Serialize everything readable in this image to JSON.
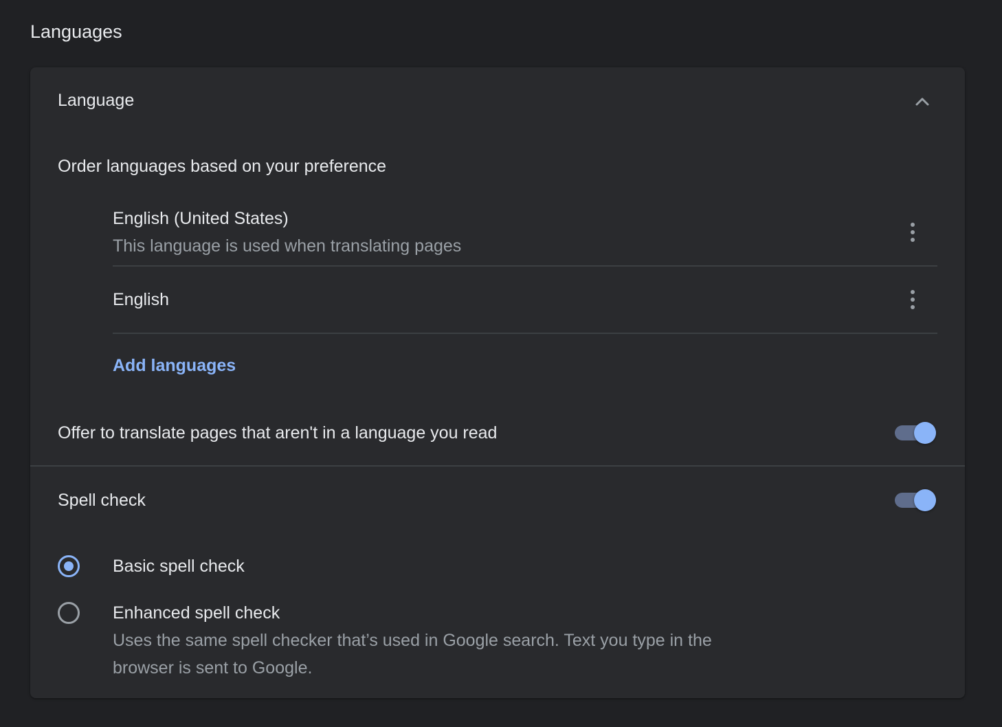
{
  "page": {
    "title": "Languages"
  },
  "language_section": {
    "title": "Language",
    "expanded": true,
    "chevron_icon": "chevron-up-icon",
    "order_label": "Order languages based on your preference",
    "languages": [
      {
        "name": "English (United States)",
        "description": "This language is used when translating pages",
        "menu_icon": "more-vert-icon"
      },
      {
        "name": "English",
        "description": "",
        "menu_icon": "more-vert-icon"
      }
    ],
    "add_languages_label": "Add languages",
    "offer_translate": {
      "label": "Offer to translate pages that aren't in a language you read",
      "enabled": true
    }
  },
  "spell_check": {
    "label": "Spell check",
    "enabled": true,
    "options": [
      {
        "label": "Basic spell check",
        "description": "",
        "selected": true
      },
      {
        "label": "Enhanced spell check",
        "description_line1": "Uses the same spell checker that’s used in Google search. Text you type in the",
        "description_line2": "browser is sent to Google.",
        "selected": false
      }
    ]
  },
  "colors": {
    "background": "#202124",
    "card": "#292a2d",
    "accent": "#8ab4f8",
    "text_primary": "#e8eaed",
    "text_secondary": "#9aa0a6"
  }
}
